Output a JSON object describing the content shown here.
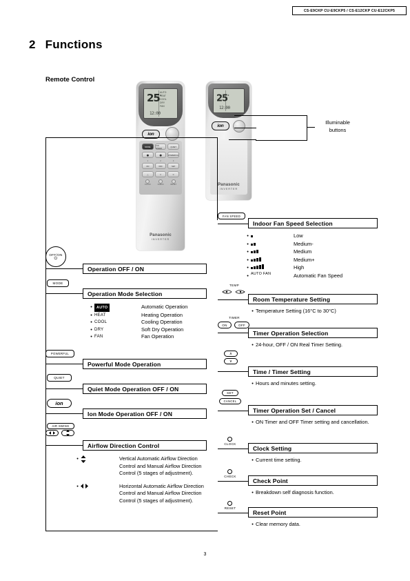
{
  "header": {
    "model_codes": "CS-E9CKP CU-E9CKP5 / CS-E12CKP CU-E12CKP5"
  },
  "chapter": {
    "number": "2",
    "title": "Functions"
  },
  "section": {
    "title": "Remote Control"
  },
  "remote_display": {
    "temperature": "25",
    "degree": "°",
    "clock": "12:00",
    "temp_label": "TEMP",
    "ion_label": "ion",
    "brand": "Panasonic",
    "brand_sub": "INVERTER",
    "lcd_side_lines": [
      "AUTO",
      "HEAT",
      "COOL",
      "DRY",
      "FAN"
    ],
    "buttons_row1": [
      "MODE",
      "FAN SPEED",
      "QUIET"
    ],
    "buttons_row2": [
      "AIR SWING",
      "AIR SWING",
      "POWERFUL"
    ],
    "buttons_row3": [
      "ON",
      "OFF",
      "SET"
    ],
    "buttons_row4": [
      "CLOCK",
      "CHECK",
      "RESET"
    ],
    "small_labels": [
      "CLOCK",
      "CHECK",
      "RESET"
    ]
  },
  "callout": {
    "label_line1": "Illuminable",
    "label_line2": "buttons"
  },
  "functions": [
    {
      "key": "OFF/ON",
      "key_sub": "⏻",
      "heading": "Operation OFF / ON",
      "items": []
    },
    {
      "key": "MODE",
      "heading": "Operation Mode Selection",
      "items": [
        {
          "symbol": "AUTO",
          "symbol_style": "chip",
          "text": "Automatic Operation"
        },
        {
          "symbol": "HEAT",
          "symbol_style": "plain",
          "text": "Heating Operation"
        },
        {
          "symbol": "COOL",
          "symbol_style": "plain",
          "text": "Cooling Operation"
        },
        {
          "symbol": "DRY",
          "symbol_style": "plain",
          "text": "Soft Dry Operation"
        },
        {
          "symbol": "FAN",
          "symbol_style": "plain",
          "text": "Fan Operation"
        }
      ]
    },
    {
      "key": "POWERFUL",
      "heading": "Powerful Mode Operation",
      "items": []
    },
    {
      "key": "QUIET",
      "heading": "Quiet Mode Operation OFF / ON",
      "items": []
    },
    {
      "key": "ion",
      "heading": "Ion Mode Operation OFF / ON",
      "items": []
    },
    {
      "key": "AIR SWING",
      "heading": "Airflow Direction Control",
      "items": [
        {
          "symbol": "vertical-arrows",
          "symbol_style": "glyph",
          "text": "Vertical Automatic Airflow Direction Control and Manual Airflow Direction Control (5 stages of adjustment)."
        },
        {
          "symbol": "horizontal-arrows",
          "symbol_style": "glyph",
          "text": "Horizontal Automatic Airflow Direction Control and Manual Airflow Direction Control (5 stages of adjustment)."
        }
      ]
    }
  ],
  "functions_right": [
    {
      "key": "FAN SPEED",
      "heading": "Indoor Fan Speed Selection",
      "items": [
        {
          "bars": 1,
          "text": "Low"
        },
        {
          "bars": 2,
          "text": "Medium-"
        },
        {
          "bars": 3,
          "text": "Medium"
        },
        {
          "bars": 4,
          "text": "Medium+"
        },
        {
          "bars": 5,
          "text": "High"
        },
        {
          "bars": 0,
          "symbol": "AUTO FAN",
          "text": "Automatic Fan Speed"
        }
      ]
    },
    {
      "key": "TEMP",
      "heading": "Room Temperature Setting",
      "items": [
        {
          "text": "Temperature Setting (16°C to 30°C)"
        }
      ]
    },
    {
      "key": "TIMER",
      "key_sub1": "ON",
      "key_sub2": "OFF",
      "heading": "Timer Operation Selection",
      "items": [
        {
          "text": "24-hour, OFF / ON Real Timer Setting."
        }
      ]
    },
    {
      "key": "∧ ∨",
      "heading": "Time / Timer Setting",
      "items": [
        {
          "text": "Hours and minutes setting."
        }
      ]
    },
    {
      "key": "SET",
      "key_sub1": "CANCEL",
      "heading": "Timer Operation Set / Cancel",
      "items": [
        {
          "text": "ON Timer and OFF Timer setting and cancellation."
        }
      ]
    },
    {
      "key": "CLOCK",
      "heading": "Clock Setting",
      "items": [
        {
          "text": "Current time setting."
        }
      ]
    },
    {
      "key": "CHECK",
      "heading": "Check Point",
      "items": [
        {
          "text": "Breakdown self diagnosis function."
        }
      ]
    },
    {
      "key": "RESET",
      "heading": "Reset Point",
      "items": [
        {
          "text": "Clear memory data."
        }
      ]
    }
  ],
  "footer": {
    "page_number": "3"
  }
}
